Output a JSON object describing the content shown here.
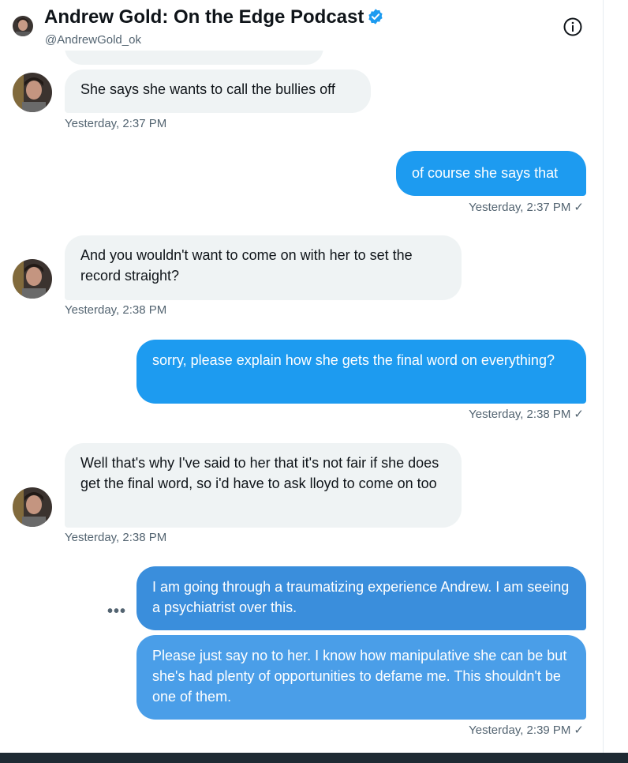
{
  "header": {
    "title": "Andrew Gold: On the Edge Podcast",
    "handle": "@AndrewGold_ok"
  },
  "messages": [
    {
      "direction": "in",
      "text": "She says she wants to call the bullies off",
      "timestamp": "Yesterday, 2:37 PM"
    },
    {
      "direction": "out",
      "text": "of course she says that",
      "timestamp": "Yesterday, 2:37 PM"
    },
    {
      "direction": "in",
      "text": "And you wouldn't want to come on with her to set the record straight?",
      "timestamp": "Yesterday, 2:38 PM"
    },
    {
      "direction": "out",
      "text": "sorry, please explain how she gets the final word on everything?",
      "timestamp": "Yesterday, 2:38 PM"
    },
    {
      "direction": "in",
      "text": "Well that's why I've said to her that it's not fair if she does get the final word, so i'd have to ask lloyd to come on too",
      "timestamp": "Yesterday, 2:38 PM"
    },
    {
      "direction": "out",
      "text": "I am going through a traumatizing experience Andrew. I am seeing a psychiatrist over this."
    },
    {
      "direction": "out",
      "text": "Please just say no to her. I know how manipulative she can be but she's had plenty of opportunities to defame me. This shouldn't be one of them.",
      "timestamp": "Yesterday, 2:39 PM"
    }
  ],
  "icons": {
    "sent": "checkmark-icon",
    "info": "info-icon",
    "verified": "verified-badge-icon",
    "more": "more-options-icon"
  },
  "ui": {
    "check_mark": "✓",
    "more_dots": "•••"
  },
  "colors": {
    "outgoing_bubble": "#1d9bf0",
    "incoming_bubble": "#eff3f4",
    "verified": "#1d9bf0"
  }
}
